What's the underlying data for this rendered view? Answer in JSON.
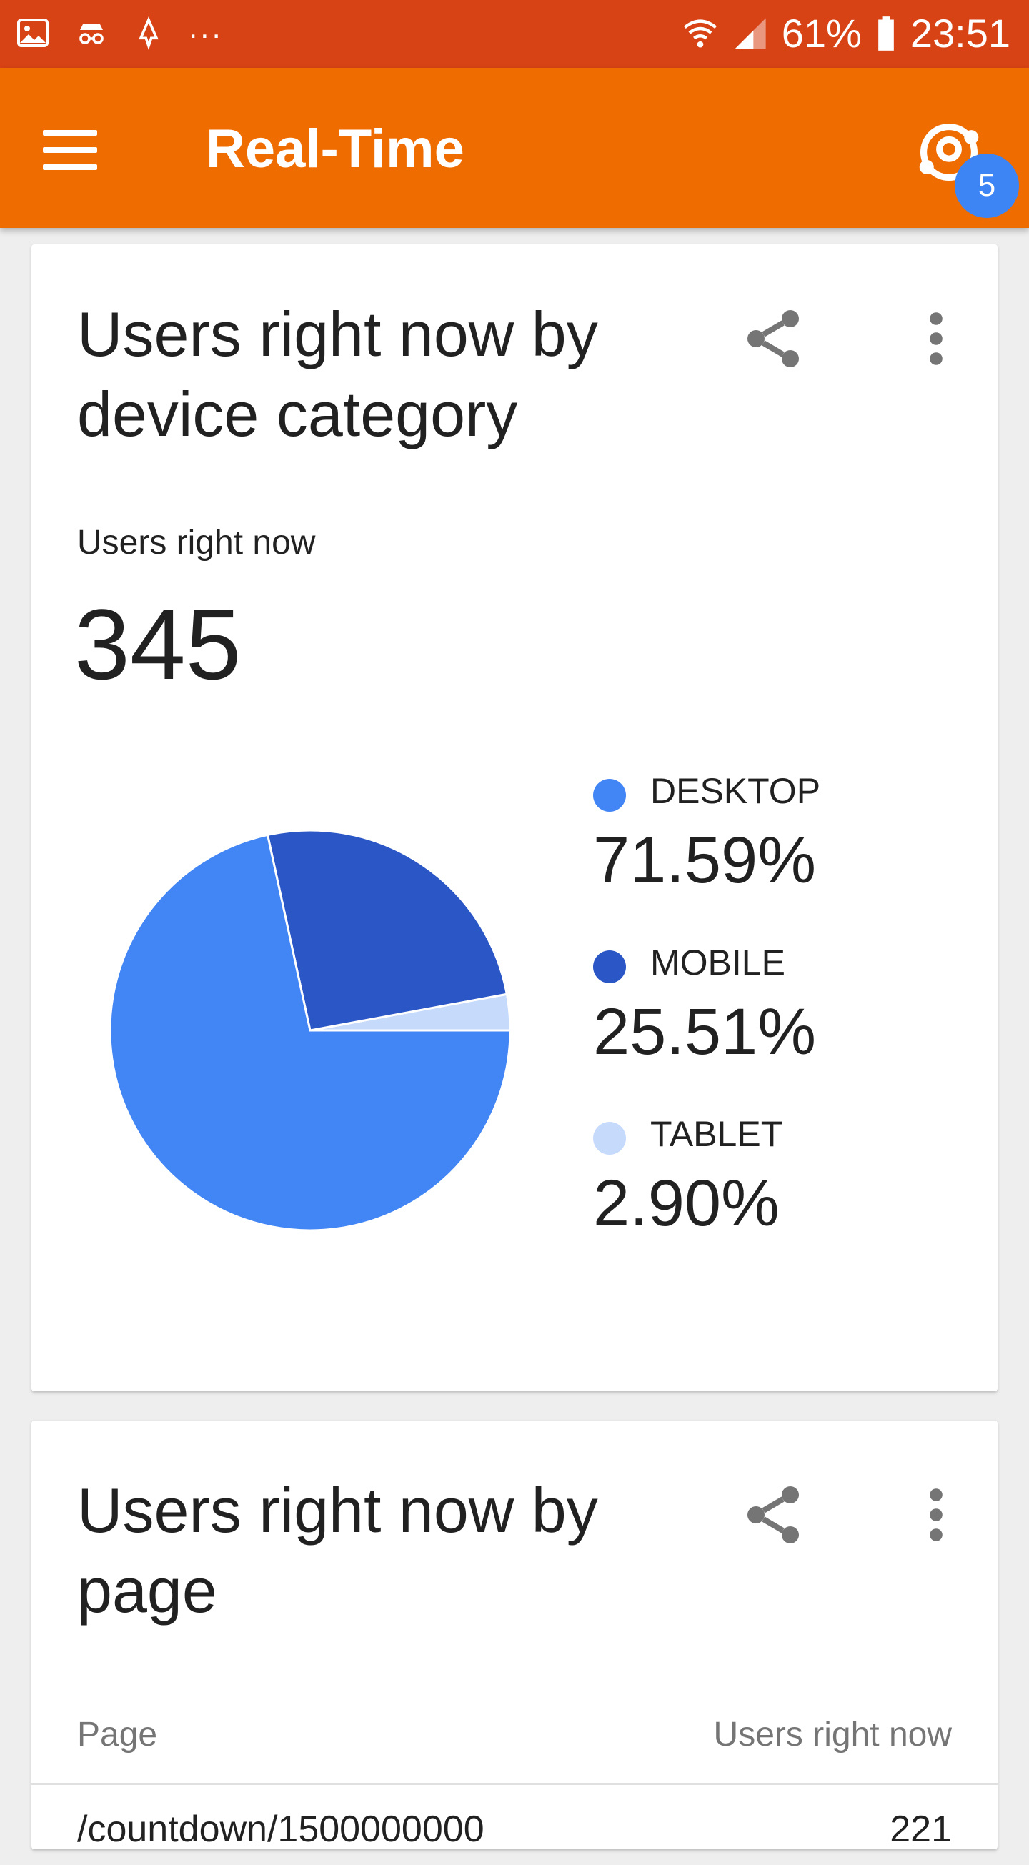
{
  "status_bar": {
    "more": "...",
    "battery": "61%",
    "time": "23:51"
  },
  "app_bar": {
    "title": "Real-Time",
    "badge_count": "5"
  },
  "device_card": {
    "title": "Users right now by device category",
    "metric_label": "Users right now",
    "metric_value": "345",
    "legend": [
      {
        "name": "DESKTOP",
        "value": "71.59%",
        "color": "#4285f4"
      },
      {
        "name": "MOBILE",
        "value": "25.51%",
        "color": "#2b56c6"
      },
      {
        "name": "TABLET",
        "value": "2.90%",
        "color": "#c6dafc"
      }
    ]
  },
  "chart_data": {
    "type": "pie",
    "categories": [
      "DESKTOP",
      "MOBILE",
      "TABLET"
    ],
    "values": [
      71.59,
      25.51,
      2.9
    ],
    "colors": [
      "#4285f4",
      "#2b56c6",
      "#c6dafc"
    ]
  },
  "page_card": {
    "title": "Users right now by page",
    "columns": [
      "Page",
      "Users right now"
    ],
    "rows": [
      {
        "page": "/countdown/1500000000",
        "users": "221"
      }
    ]
  },
  "icons": {
    "menu": "menu-icon",
    "user_account": "account-circle-icon",
    "share": "share-icon",
    "more": "more-vert-icon"
  }
}
